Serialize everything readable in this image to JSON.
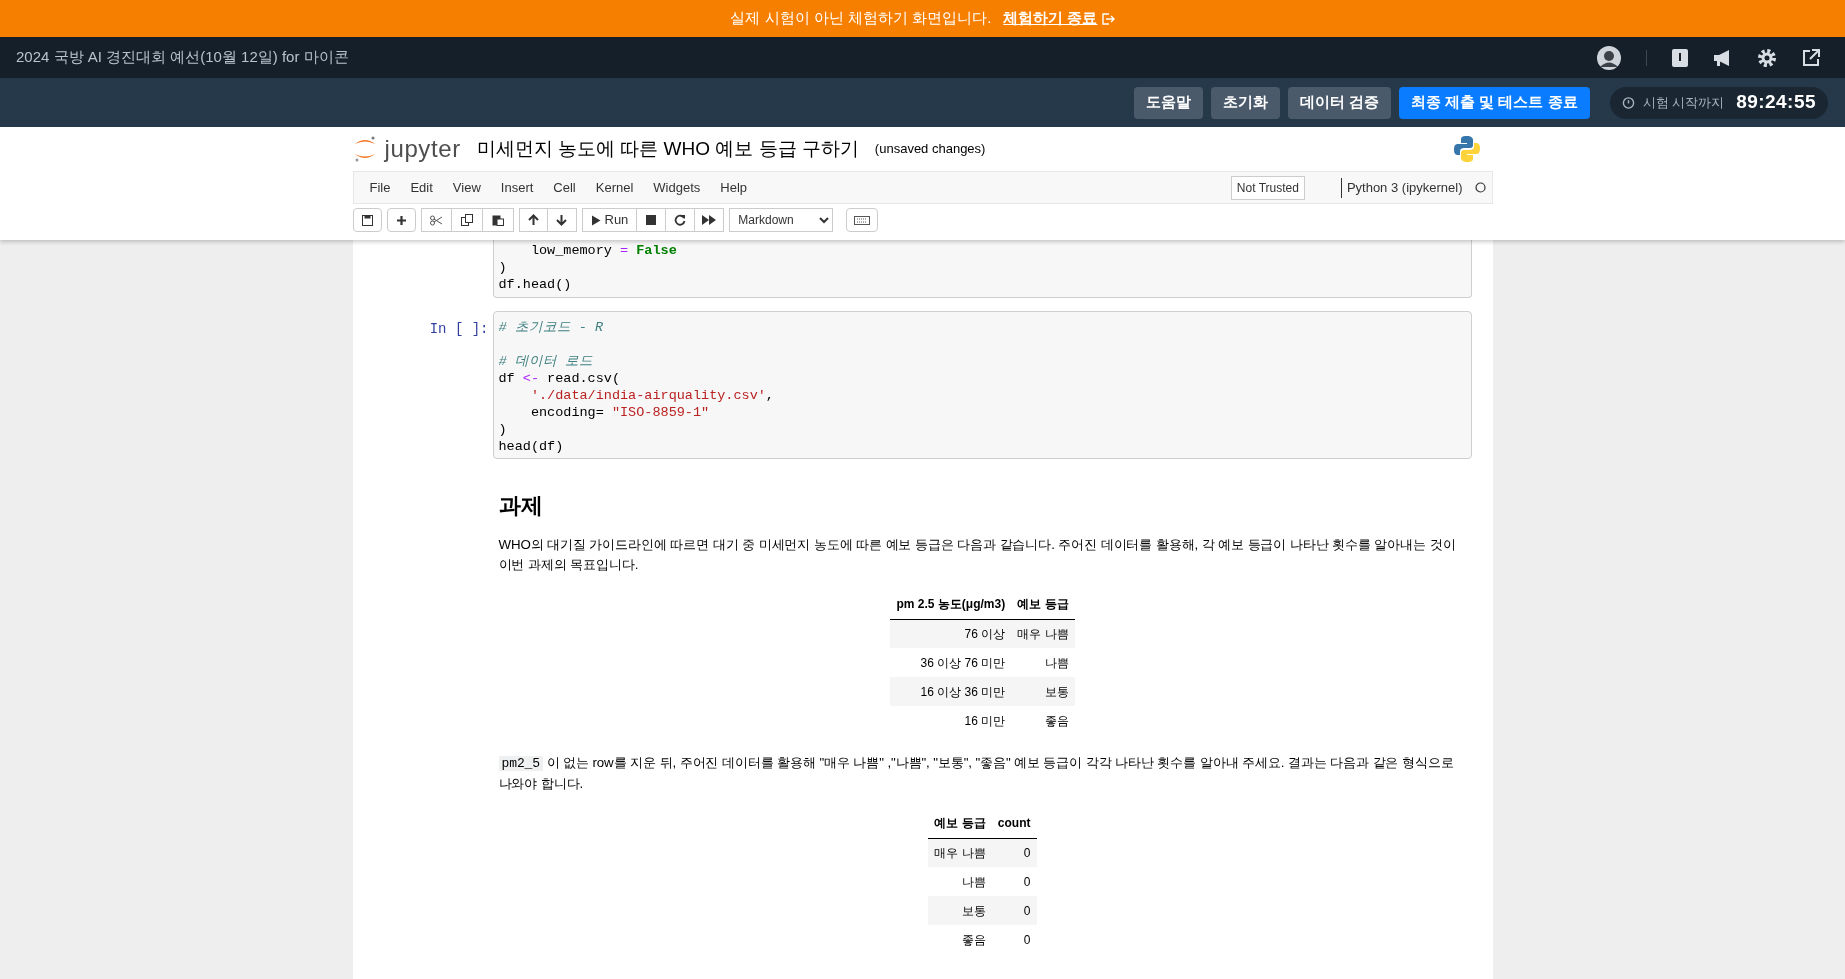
{
  "banner": {
    "text": "실제 시험이 아닌 체험하기 화면입니다.",
    "link": "체험하기 종료"
  },
  "topbar": {
    "title": "2024 국방 AI 경진대회 예선(10월 12일) for 마이콘"
  },
  "actions": [
    {
      "label": "도움말",
      "kind": "default"
    },
    {
      "label": "초기화",
      "kind": "default"
    },
    {
      "label": "데이터 검증",
      "kind": "default"
    },
    {
      "label": "최종 제출 및 테스트 종료",
      "kind": "primary"
    }
  ],
  "timer": {
    "label": "시험 시작까지",
    "value": "89:24:55"
  },
  "notebook": {
    "logo_text": "jupyter",
    "title": "미세먼지 농도에 따른 WHO 예보 등급 구하기",
    "status": "(unsaved changes)"
  },
  "menu": [
    "File",
    "Edit",
    "View",
    "Insert",
    "Cell",
    "Kernel",
    "Widgets",
    "Help"
  ],
  "trusted": "Not Trusted",
  "kernel": "Python 3 (ipykernel)",
  "toolbar": {
    "run": "Run",
    "cell_type": "Markdown"
  },
  "cells": [
    {
      "kind": "code",
      "lines": [
        {
          "kind": "code",
          "segments": [
            {
              "text": "    low_memory ",
              "kind": "plain"
            },
            {
              "text": "=",
              "kind": "op"
            },
            {
              "text": " False",
              "kind": "keyword"
            }
          ]
        },
        {
          "kind": "code",
          "segments": [
            {
              "text": ")",
              "kind": "plain"
            }
          ]
        },
        {
          "kind": "code",
          "segments": [
            {
              "text": "df.head()",
              "kind": "plain"
            }
          ]
        }
      ]
    },
    {
      "kind": "code",
      "prompt": "In [ ]:",
      "lines": [
        {
          "kind": "code",
          "segments": [
            {
              "text": "# 초기코드 - R",
              "kind": "comment"
            }
          ]
        },
        {
          "kind": "blank"
        },
        {
          "kind": "code",
          "segments": [
            {
              "text": "# 데이터 로드",
              "kind": "comment"
            }
          ]
        },
        {
          "kind": "code",
          "segments": [
            {
              "text": "df ",
              "kind": "plain"
            },
            {
              "text": "<-",
              "kind": "op"
            },
            {
              "text": " read.csv(",
              "kind": "plain"
            }
          ]
        },
        {
          "kind": "code",
          "segments": [
            {
              "text": "    './data/india-airquality.csv'",
              "kind": "string"
            },
            {
              "text": ",",
              "kind": "plain"
            }
          ]
        },
        {
          "kind": "code",
          "segments": [
            {
              "text": "    encoding= ",
              "kind": "plain"
            },
            {
              "text": "\"ISO-8859-1\"",
              "kind": "string"
            }
          ]
        },
        {
          "kind": "code",
          "segments": [
            {
              "text": ")",
              "kind": "plain"
            }
          ]
        },
        {
          "kind": "code",
          "segments": [
            {
              "text": "head(df)",
              "kind": "plain"
            }
          ]
        }
      ]
    },
    {
      "kind": "markdown",
      "blocks": [
        {
          "kind": "heading",
          "text": "과제"
        },
        {
          "kind": "paragraph",
          "text": "WHO의 대기질 가이드라인에 따르면 대기 중 미세먼지 농도에 따른 예보 등급은 다음과 같습니다. 주어진 데이터를 활용해, 각 예보 등급이 나타난 횟수를 알아내는 것이 이번 과제의 목표입니다."
        },
        {
          "kind": "table",
          "columns": [
            "pm 2.5 농도(μg/m3)",
            "예보 등급"
          ],
          "rows": [
            [
              "76 이상",
              "매우 나쁨"
            ],
            [
              "36 이상 76 미만",
              "나쁨"
            ],
            [
              "16 이상 36 미만",
              "보통"
            ],
            [
              "16 미만",
              "좋음"
            ]
          ]
        },
        {
          "kind": "paragraph",
          "code": "pm2_5",
          "text": " 이 없는 row를 지운 뒤, 주어진 데이터를 활용해 \"매우 나쁨\" ,\"나쁨\", \"보통\", \"좋음\" 예보 등급이 각각 나타난 횟수를 알아내 주세요. 결과는 다음과 같은 형식으로 나와야 합니다."
        },
        {
          "kind": "table",
          "columns": [
            "예보 등급",
            "count"
          ],
          "rows": [
            [
              "매우 나쁨",
              "0"
            ],
            [
              "나쁨",
              "0"
            ],
            [
              "보통",
              "0"
            ],
            [
              "좋음",
              "0"
            ]
          ]
        }
      ]
    }
  ]
}
